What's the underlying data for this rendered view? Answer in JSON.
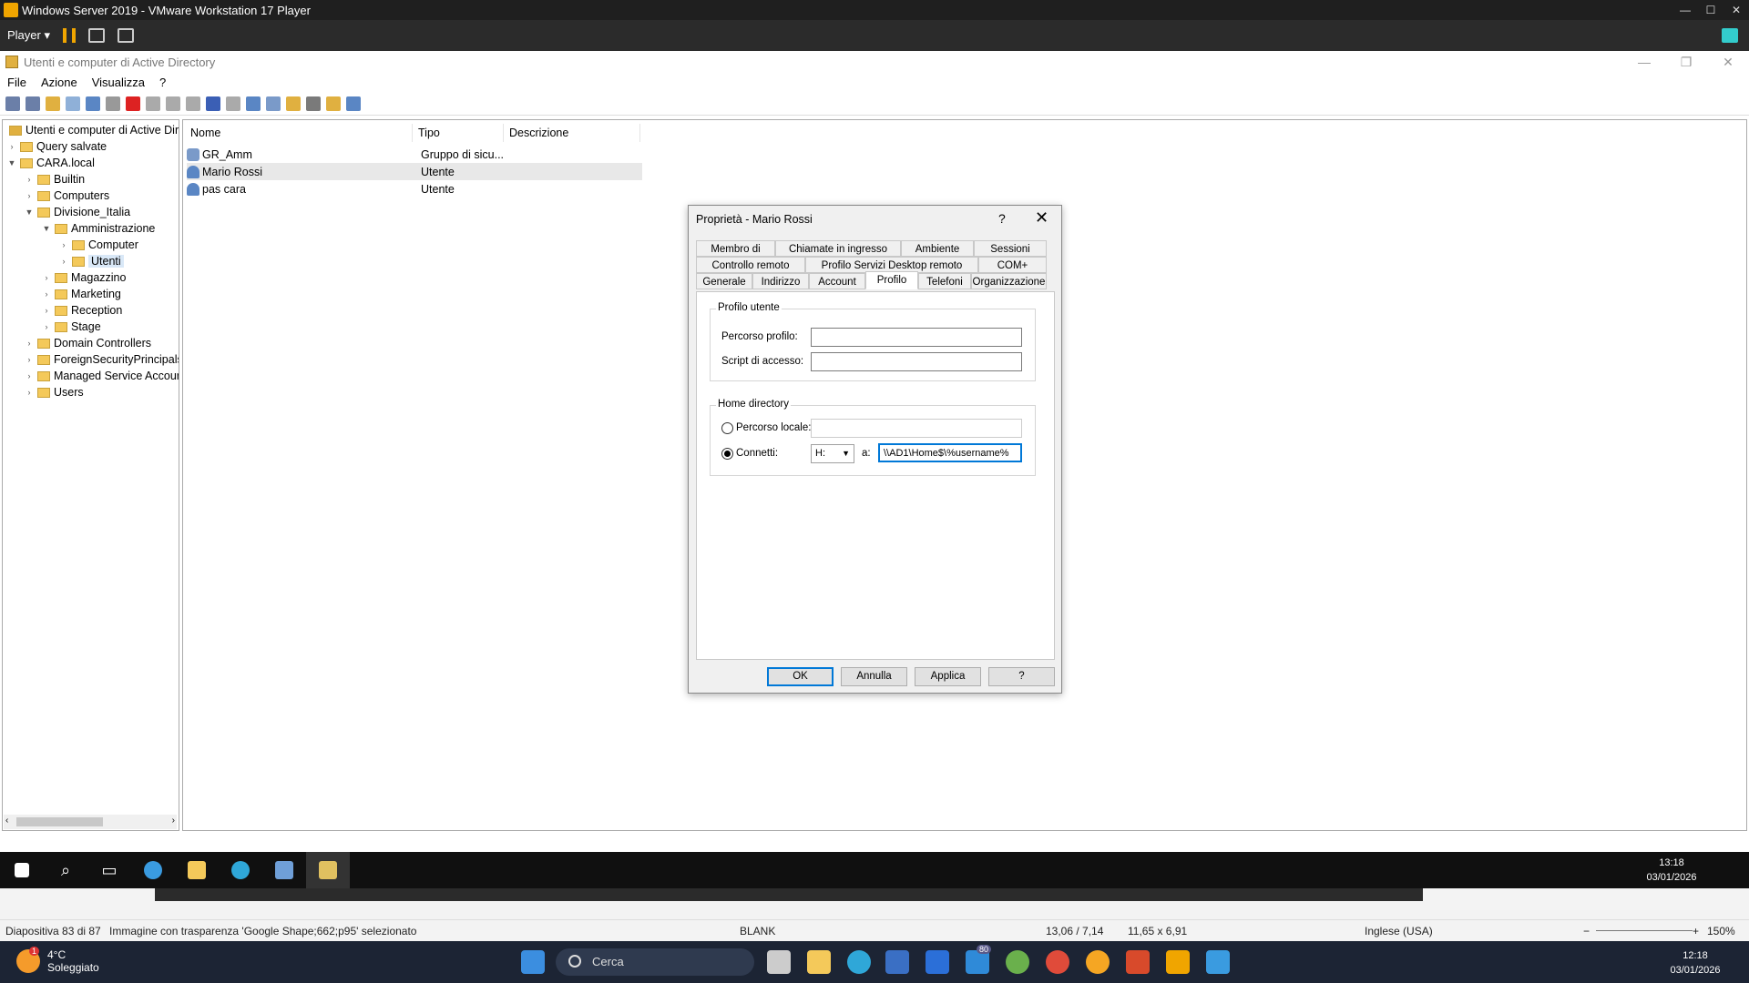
{
  "vmware": {
    "title": "Windows Server 2019 - VMware Workstation 17 Player",
    "player_label": "Player ▾"
  },
  "ad_window": {
    "title": "Utenti e computer di Active Directory",
    "menu": [
      "File",
      "Azione",
      "Visualizza",
      "?"
    ]
  },
  "tree": {
    "root": "Utenti e computer di Active Dire",
    "items": [
      {
        "label": "Query salvate",
        "level": 1,
        "expanded": false
      },
      {
        "label": "CARA.local",
        "level": 1,
        "expanded": true
      },
      {
        "label": "Builtin",
        "level": 2,
        "expanded": false
      },
      {
        "label": "Computers",
        "level": 2,
        "expanded": false
      },
      {
        "label": "Divisione_Italia",
        "level": 2,
        "expanded": true
      },
      {
        "label": "Amministrazione",
        "level": 3,
        "expanded": true
      },
      {
        "label": "Computer",
        "level": 4,
        "expanded": false
      },
      {
        "label": "Utenti",
        "level": 4,
        "expanded": false,
        "selected": true
      },
      {
        "label": "Magazzino",
        "level": 3,
        "expanded": false
      },
      {
        "label": "Marketing",
        "level": 3,
        "expanded": false
      },
      {
        "label": "Reception",
        "level": 3,
        "expanded": false
      },
      {
        "label": "Stage",
        "level": 3,
        "expanded": false
      },
      {
        "label": "Domain Controllers",
        "level": 2,
        "expanded": false
      },
      {
        "label": "ForeignSecurityPrincipals",
        "level": 2,
        "expanded": false
      },
      {
        "label": "Managed Service Accour",
        "level": 2,
        "expanded": false
      },
      {
        "label": "Users",
        "level": 2,
        "expanded": false
      }
    ]
  },
  "list": {
    "headers": [
      "Nome",
      "Tipo",
      "Descrizione"
    ],
    "rows": [
      {
        "name": "GR_Amm",
        "type": "Gruppo di sicu...",
        "icon": "group-icon"
      },
      {
        "name": "Mario Rossi",
        "type": "Utente",
        "icon": "user-icon",
        "selected": true
      },
      {
        "name": "pas cara",
        "type": "Utente",
        "icon": "user-icon"
      }
    ]
  },
  "dialog": {
    "title": "Proprietà - Mario Rossi",
    "help_glyph": "?",
    "close_glyph": "✕",
    "tabs_row1": [
      "Membro di",
      "Chiamate in ingresso",
      "Ambiente",
      "Sessioni"
    ],
    "tabs_row2": [
      "Controllo remoto",
      "Profilo Servizi Desktop remoto",
      "COM+"
    ],
    "tabs_row3": [
      "Generale",
      "Indirizzo",
      "Account",
      "Profilo",
      "Telefoni",
      "Organizzazione"
    ],
    "active_tab": "Profilo",
    "profile_group": "Profilo utente",
    "profile_path_label": "Percorso profilo:",
    "profile_path_value": "",
    "logon_script_label": "Script di accesso:",
    "logon_script_value": "",
    "home_group": "Home directory",
    "local_path_label": "Percorso locale:",
    "local_path_value": "",
    "connect_label": "Connetti:",
    "drive_value": "H:",
    "to_label": "a:",
    "connect_path_value": "\\\\AD1\\Home$\\%username%",
    "buttons": {
      "ok": "OK",
      "cancel": "Annulla",
      "apply": "Applica",
      "help": "?"
    }
  },
  "guest_taskbar": {
    "time": "13:18",
    "date": "03/01/2026"
  },
  "host_status": {
    "slide": "Diapositiva 83 di 87",
    "selection": "Immagine con trasparenza 'Google Shape;662;p95' selezionato",
    "layout": "BLANK",
    "position": "13,06 / 7,14",
    "size": "11,65 x 6,91",
    "language": "Inglese (USA)",
    "zoom": "150%",
    "zoom_minus": "−",
    "zoom_plus": "+"
  },
  "host_taskbar": {
    "temperature": "4°C",
    "weather": "Soleggiato",
    "weather_badge": "1",
    "search_placeholder": "Cerca",
    "time": "12:18",
    "date": "03/01/2026",
    "badge": "80"
  },
  "colors": {
    "accent": "#0078d7",
    "folder": "#f4c95a",
    "vm_bar": "#1f1f1f"
  }
}
